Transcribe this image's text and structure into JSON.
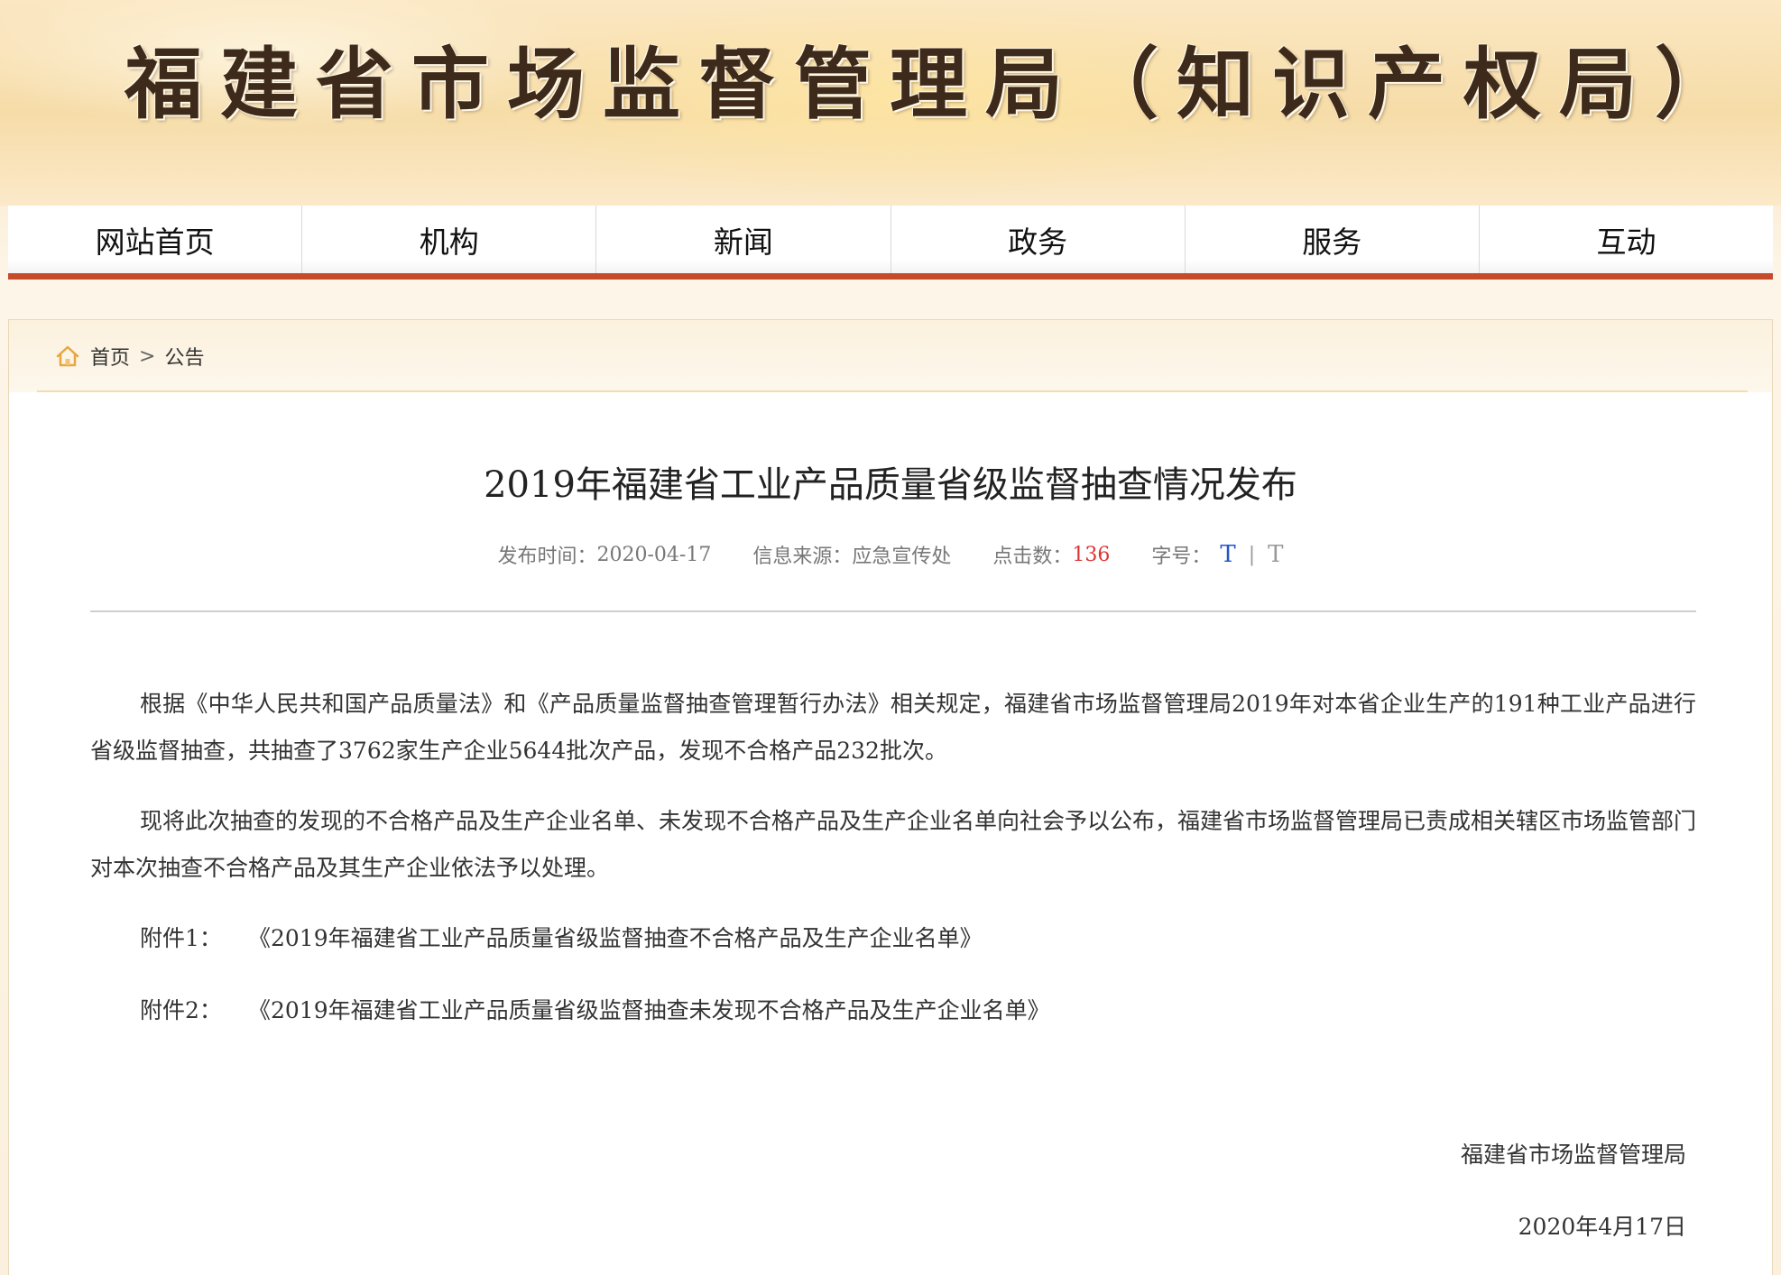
{
  "header": {
    "site_title": "福建省市场监督管理局（知识产权局）"
  },
  "nav": {
    "items": [
      {
        "label": "网站首页"
      },
      {
        "label": "机构"
      },
      {
        "label": "新闻"
      },
      {
        "label": "政务"
      },
      {
        "label": "服务"
      },
      {
        "label": "互动"
      }
    ]
  },
  "breadcrumb": {
    "icon": "home-icon",
    "items": [
      {
        "label": "首页"
      },
      {
        "label": "公告"
      }
    ],
    "separator": ">"
  },
  "article": {
    "title": "2019年福建省工业产品质量省级监督抽查情况发布",
    "meta": {
      "date_label": "发布时间：",
      "date_value": "2020-04-17",
      "source_label": "信息来源：",
      "source_value": "应急宣传处",
      "hits_label": "点击数：",
      "hits_value": "136",
      "font_label": "字号：",
      "font_large": "T",
      "font_sep": "|",
      "font_small": "T"
    },
    "paragraphs": [
      "根据《中华人民共和国产品质量法》和《产品质量监督抽查管理暂行办法》相关规定，福建省市场监督管理局2019年对本省企业生产的191种工业产品进行省级监督抽查，共抽查了3762家生产企业5644批次产品，发现不合格产品232批次。",
      "现将此次抽查的发现的不合格产品及生产企业名单、未发现不合格产品及生产企业名单向社会予以公布，福建省市场监督管理局已责成相关辖区市场监管部门对本次抽查不合格产品及其生产企业依法予以处理。"
    ],
    "attachments": [
      {
        "label": "附件1：",
        "title": "《2019年福建省工业产品质量省级监督抽查不合格产品及生产企业名单》"
      },
      {
        "label": "附件2：",
        "title": "《2019年福建省工业产品质量省级监督抽查未发现不合格产品及生产企业名单》"
      }
    ],
    "signature": "福建省市场监督管理局",
    "signature_date": "2020年4月17日"
  },
  "colors": {
    "nav_underline": "#c74a2b",
    "hits": "#dd3333",
    "font_large": "#2255cc"
  }
}
